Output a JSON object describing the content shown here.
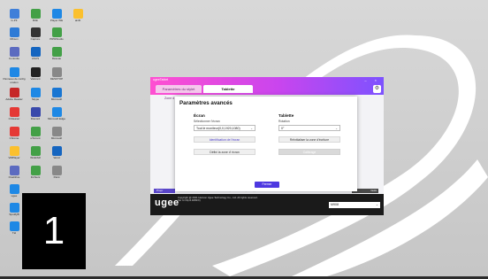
{
  "desktop": {
    "icons": [
      {
        "label": "G-PF",
        "color": "#3f7fd9"
      },
      {
        "label": "Bibli",
        "color": "#43a047"
      },
      {
        "label": "Player WE",
        "color": "#1e88e5"
      },
      {
        "label": "ainfit",
        "color": "#fbc02d"
      },
      {
        "label": "Ribson",
        "color": "#2e7bd6"
      },
      {
        "label": "Capture",
        "color": "#333333"
      },
      {
        "label": "PRWStudio",
        "color": "#43a047"
      },
      {
        "label": "Controlle",
        "color": "#5c6bc0"
      },
      {
        "label": "ASUS",
        "color": "#1565c0"
      },
      {
        "label": "Réseau",
        "color": "#43a047"
      },
      {
        "label": "Panneau de configuration",
        "color": "#1e88e5"
      },
      {
        "label": "Valorant",
        "color": "#222222"
      },
      {
        "label": "DESKTOP",
        "color": "#888888"
      },
      {
        "label": "Adobe Reader",
        "color": "#c62828"
      },
      {
        "label": "Skype",
        "color": "#1e88e5"
      },
      {
        "label": "Microsoft",
        "color": "#1976d2"
      },
      {
        "label": "CCleaner",
        "color": "#e53935"
      },
      {
        "label": "Discord",
        "color": "#3949ab"
      },
      {
        "label": "Microsoft Edge",
        "color": "#1e88e5"
      },
      {
        "label": "Chrome",
        "color": "#e53935"
      },
      {
        "label": "uTorrent",
        "color": "#43a047"
      },
      {
        "label": "Microsoft",
        "color": "#888888"
      },
      {
        "label": "VMPlayer",
        "color": "#fbc02d"
      },
      {
        "label": "WinRAR",
        "color": "#43a047"
      },
      {
        "label": "Word",
        "color": "#1565c0"
      },
      {
        "label": "OneDrive",
        "color": "#5c6bc0"
      },
      {
        "label": "Fichiers",
        "color": "#43a047"
      },
      {
        "label": "Paint",
        "color": "#888888"
      },
      {
        "label": "ugee",
        "color": "#1e88e5"
      },
      {
        "label": "SpotifyB",
        "color": "#1e88e5"
      },
      {
        "label": "Tél",
        "color": "#1e88e5"
      }
    ],
    "big_number": "1"
  },
  "window": {
    "title": "ugeeTablet",
    "controls": "– ×",
    "tabs": [
      "Paramètres du stylet",
      "Tablette"
    ],
    "zone_tab": "Zone d",
    "logo": "ugee",
    "copyright": "Copyright @ 2021 Hanvon Ugee Technology Co., Ltd. All rights reserved.",
    "version": "Ver 4.1.9(v4.4083/X)",
    "model": "M908",
    "bg_left_button": "Propr",
    "bg_right_button": "fauts",
    "bg_link": "Nos pilotes ou nos pour rapport comme"
  },
  "dialog": {
    "title": "Paramètres avancés",
    "screen": {
      "heading": "Écran",
      "sub": "Sélectionner l'écran",
      "value": "Tout le moniteur(0,0,1920,1080)",
      "identify": "Identification de l'écran",
      "default": "Défini la zone d' écran"
    },
    "tablet": {
      "heading": "Tablette",
      "sub": "Rotation",
      "value": "0°",
      "reset": "Réinitialiser la zone d'écriture",
      "calibrate": "Calibrage"
    },
    "close": "Fermer"
  },
  "colors": {
    "accent": "#4d38e0",
    "header_gradient_start": "#ff4fd1",
    "header_gradient_end": "#7d52ff"
  }
}
